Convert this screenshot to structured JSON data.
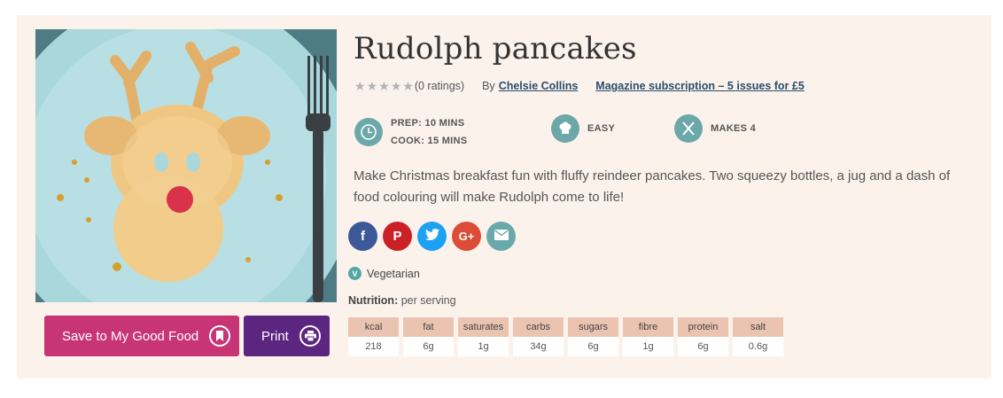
{
  "recipe": {
    "title": "Rudolph pancakes",
    "ratings_text": "(0 ratings)",
    "stars": [
      "★",
      "★",
      "★",
      "★",
      "★"
    ],
    "by_label": "By",
    "author": "Chelsie Collins",
    "subscription_link": "Magazine subscription – 5 issues for £5",
    "prep_label": "PREP:",
    "prep_value": "10 MINS",
    "cook_label": "COOK:",
    "cook_value": "15 MINS",
    "difficulty": "EASY",
    "makes": "MAKES 4",
    "description": "Make Christmas breakfast fun with fluffy reindeer pancakes. Two squeezy bottles, a jug and a dash of food colouring will make Rudolph come to life!",
    "diet_badge_letter": "V",
    "diet": "Vegetarian",
    "nutrition_label": "Nutrition:",
    "nutrition_suffix": "per serving"
  },
  "actions": {
    "save_label": "Save to My Good Food",
    "print_label": "Print"
  },
  "social": {
    "facebook": "f",
    "pinterest": "P",
    "twitter_icon": "twitter-bird-icon",
    "googleplus": "G+",
    "email_icon": "envelope-icon"
  },
  "nutrition": [
    {
      "label": "kcal",
      "value": "218"
    },
    {
      "label": "fat",
      "value": "6g"
    },
    {
      "label": "saturates",
      "value": "1g"
    },
    {
      "label": "carbs",
      "value": "34g"
    },
    {
      "label": "sugars",
      "value": "6g"
    },
    {
      "label": "fibre",
      "value": "1g"
    },
    {
      "label": "protein",
      "value": "6g"
    },
    {
      "label": "salt",
      "value": "0.6g"
    }
  ],
  "colors": {
    "background": "#fcf2ec",
    "save_button": "#c73577",
    "print_button": "#5b2580",
    "fact_icon": "#6ca7a9",
    "link": "#2a4e6c",
    "nutrition_header": "#ebc3b1",
    "facebook": "#3b5998",
    "pinterest": "#cb2027",
    "twitter": "#1da1f2",
    "googleplus": "#dd4b39",
    "email": "#6aa9ab"
  }
}
